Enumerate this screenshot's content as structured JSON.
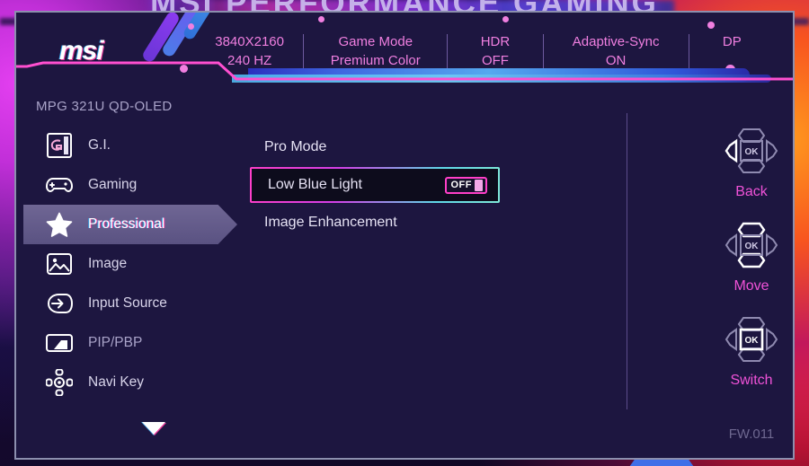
{
  "wallpaper": {
    "title": "MSI PERFORMANCE GAMING"
  },
  "osd": {
    "logo": "msi",
    "model": "MPG 321U QD-OLED",
    "firmware": "FW.011",
    "header_items": [
      {
        "line1": "3840X2160",
        "line2": "240 HZ"
      },
      {
        "line1": "Game Mode",
        "line2": "Premium Color"
      },
      {
        "line1": "HDR",
        "line2": "OFF"
      },
      {
        "line1": "Adaptive-Sync",
        "line2": "ON"
      },
      {
        "line1": "DP",
        "line2": ""
      }
    ],
    "sidebar": [
      {
        "label": "G.I.",
        "icon": "gi-badge-icon",
        "active": false
      },
      {
        "label": "Gaming",
        "icon": "gamepad-icon",
        "active": false
      },
      {
        "label": "Professional",
        "icon": "star-icon",
        "active": true
      },
      {
        "label": "Image",
        "icon": "picture-icon",
        "active": false
      },
      {
        "label": "Input Source",
        "icon": "input-arrow-icon",
        "active": false
      },
      {
        "label": "PIP/PBP",
        "icon": "pip-pbp-icon",
        "active": false
      },
      {
        "label": "Navi Key",
        "icon": "navi-key-icon",
        "active": false
      }
    ],
    "scroll_icon": "chevron-down-icon",
    "options": [
      {
        "label": "Pro Mode",
        "selected": false,
        "value": ""
      },
      {
        "label": "Low Blue Light",
        "selected": true,
        "value": "OFF"
      },
      {
        "label": "Image Enhancement",
        "selected": false,
        "value": ""
      }
    ],
    "nav_hints": [
      {
        "label": "Back",
        "icon": "joystick-left-icon",
        "ok": "OK"
      },
      {
        "label": "Move",
        "icon": "joystick-up-down-icon",
        "ok": "OK"
      },
      {
        "label": "Switch",
        "icon": "joystick-center-icon",
        "ok": "OK"
      }
    ]
  },
  "colors": {
    "accent_magenta": "#ff3fc8",
    "accent_cyan": "#5fd8e8",
    "panel_bg": "#1d1640",
    "header_text": "#f07fe0"
  }
}
